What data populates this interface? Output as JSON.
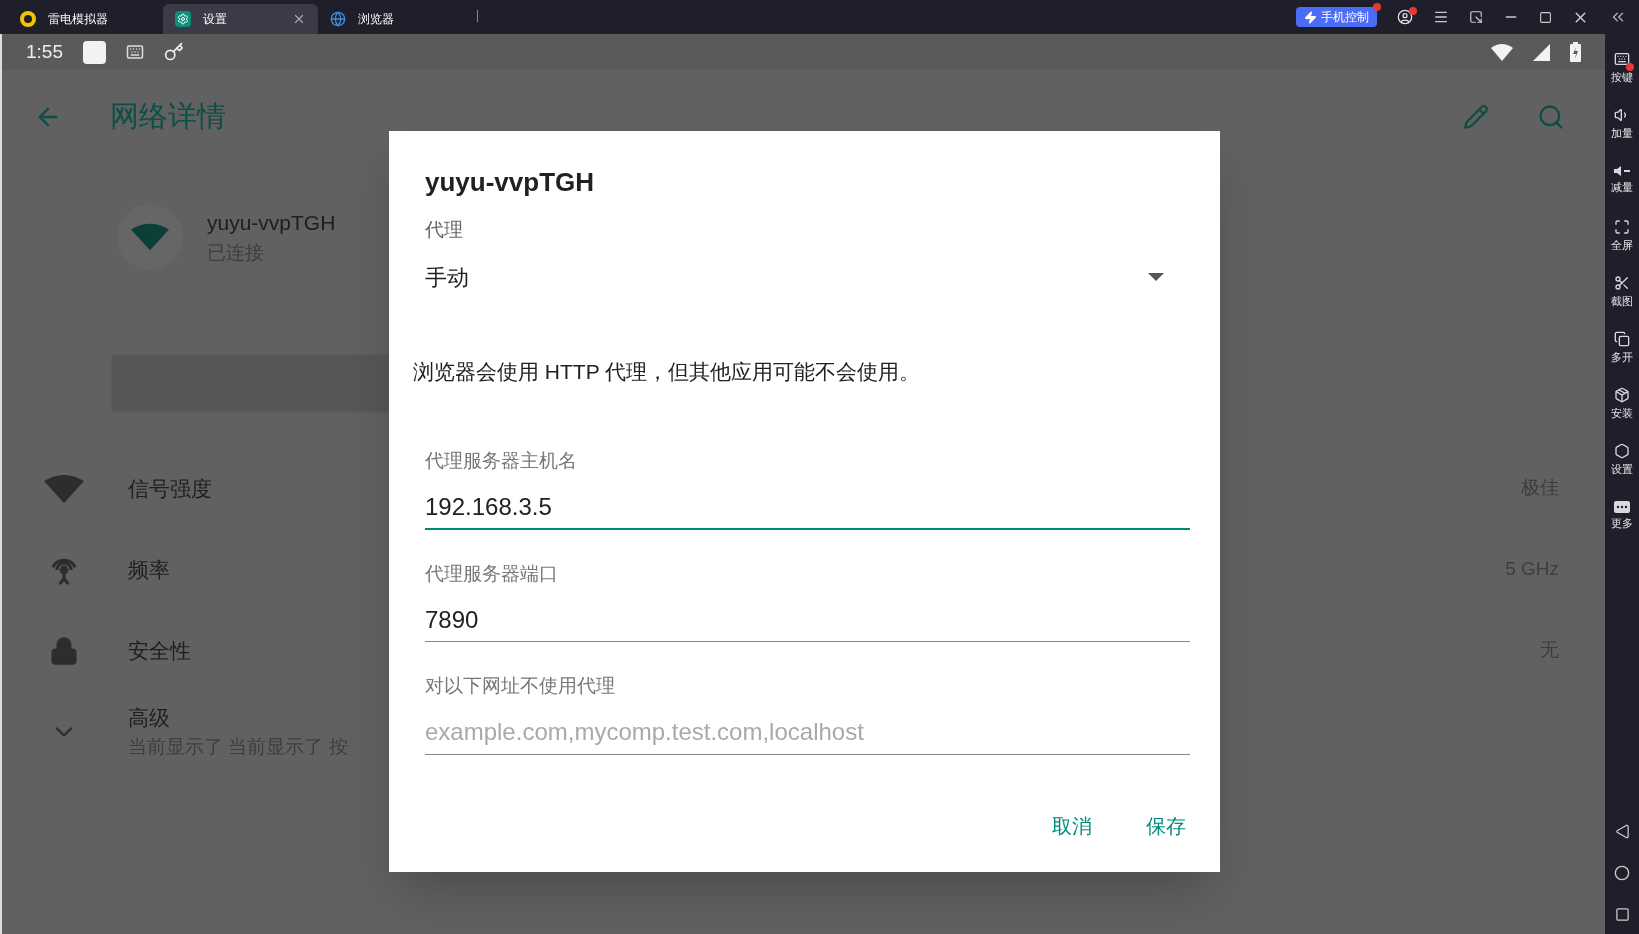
{
  "emulator_tabs": [
    {
      "label": "雷电模拟器",
      "selected": false
    },
    {
      "label": "设置",
      "selected": true
    },
    {
      "label": "浏览器",
      "selected": false
    }
  ],
  "phone_control_button": "手机控制",
  "status_bar": {
    "time": "1:55"
  },
  "app_bar": {
    "title": "网络详情"
  },
  "network": {
    "name": "yuyu-vvpTGH",
    "status": "已连接"
  },
  "details": [
    {
      "kind": "signal",
      "label": "信号强度",
      "value": "极佳"
    },
    {
      "kind": "frequency",
      "label": "频率",
      "value": "5 GHz"
    },
    {
      "kind": "security",
      "label": "安全性",
      "value": "无"
    },
    {
      "kind": "advanced",
      "label": "高级",
      "summary": "当前显示了 当前显示了 按"
    }
  ],
  "dialog": {
    "title": "yuyu-vvpTGH",
    "proxy_label": "代理",
    "proxy_value": "手动",
    "note": "浏览器会使用 HTTP 代理，但其他应用可能不会使用。",
    "fields": [
      {
        "label": "代理服务器主机名",
        "value": "192.168.3.5",
        "focused": true
      },
      {
        "label": "代理服务器端口",
        "value": "7890",
        "focused": false
      },
      {
        "label": "对以下网址不使用代理",
        "placeholder": "example.com,mycomp.test.com,localhost",
        "focused": false
      }
    ],
    "buttons": [
      "取消",
      "保存"
    ]
  },
  "side_toolbar": [
    {
      "kind": "keys",
      "label": "按键"
    },
    {
      "kind": "vol_up",
      "label": "加量"
    },
    {
      "kind": "vol_down",
      "label": "减量"
    },
    {
      "kind": "fullscreen",
      "label": "全屏"
    },
    {
      "kind": "screenshot",
      "label": "截图"
    },
    {
      "kind": "multi",
      "label": "多开"
    },
    {
      "kind": "apk",
      "label": "安装"
    },
    {
      "kind": "settings",
      "label": "设置"
    },
    {
      "kind": "more",
      "label": "更多"
    }
  ]
}
